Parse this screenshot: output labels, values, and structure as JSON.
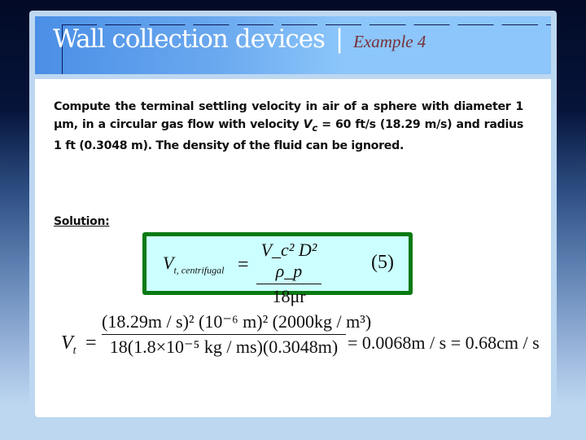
{
  "slide": {
    "title": "Wall collection devices",
    "separator": "|",
    "subtitle": "Example 4"
  },
  "problem": {
    "text_part1": "Compute the terminal settling velocity in air of a sphere with diameter 1 µm, in a circular gas flow with velocity ",
    "var_name": "V",
    "var_sub": "c",
    "text_part2": " = 60 ft/s (18.29 m/s) and radius 1 ft (0.3048 m). The density of the fluid can be ignored."
  },
  "solution": {
    "label": "Solution:"
  },
  "equation_box": {
    "lhs": "V",
    "lhs_sub": "t, centrifugal",
    "equals": "=",
    "numerator": "V_c² D² ρ_p",
    "denominator": "18μr",
    "equation_number": "(5)",
    "colors": {
      "border": "#087a12",
      "fill": "#ccffff"
    }
  },
  "calculation": {
    "lhs": "V",
    "lhs_sub": "t",
    "equals": "=",
    "numerator": "(18.29m / s)² (10⁻⁶ m)² (2000kg / m³)",
    "denominator": "18(1.8×10⁻⁵ kg / ms)(0.3048m)",
    "result": "= 0.0068m / s = 0.68cm / s"
  },
  "colors": {
    "title_text": "#ffffff",
    "subtitle_text": "#7a2f3a",
    "title_bar_start": "#4a8fe6",
    "title_bar_end": "#8cc6fa",
    "frame": "#bdd7f1"
  }
}
